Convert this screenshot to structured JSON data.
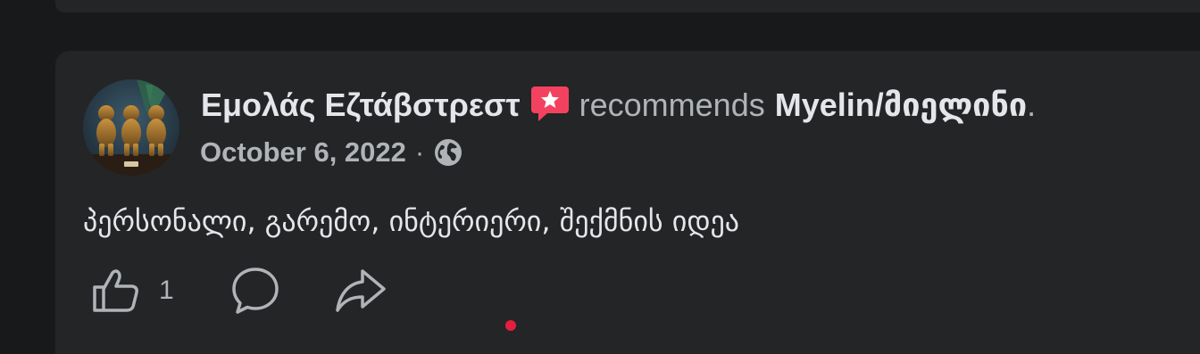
{
  "post": {
    "author": "Εμολάς Εζτάβστρεστ",
    "verb": "recommends",
    "page": "Myelin/მიელინი",
    "end_punct": ".",
    "date": "October 6, 2022",
    "separator": "·",
    "privacy_icon": "globe-icon",
    "recommend_icon": "recommend-star-icon",
    "text": "პერსონალი, გარემო, ინტერიერი, შექმნის იდეა",
    "like_count": "1",
    "actions": {
      "like_icon": "thumbs-up-icon",
      "comment_icon": "comment-bubble-icon",
      "share_icon": "share-arrow-icon"
    }
  },
  "colors": {
    "background": "#18191a",
    "card": "#242526",
    "primary_text": "#e4e6eb",
    "secondary_text": "#b0b3b8",
    "recommend_accent": "#f3425f",
    "notification_dot": "#e41e3f"
  }
}
